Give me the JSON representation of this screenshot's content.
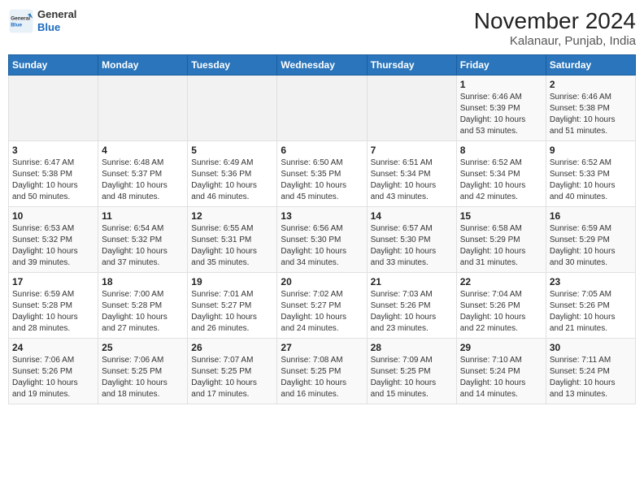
{
  "header": {
    "title": "November 2024",
    "subtitle": "Kalanaur, Punjab, India",
    "logo_line1": "General",
    "logo_line2": "Blue"
  },
  "days_of_week": [
    "Sunday",
    "Monday",
    "Tuesday",
    "Wednesday",
    "Thursday",
    "Friday",
    "Saturday"
  ],
  "weeks": [
    [
      {
        "day": "",
        "info": ""
      },
      {
        "day": "",
        "info": ""
      },
      {
        "day": "",
        "info": ""
      },
      {
        "day": "",
        "info": ""
      },
      {
        "day": "",
        "info": ""
      },
      {
        "day": "1",
        "info": "Sunrise: 6:46 AM\nSunset: 5:39 PM\nDaylight: 10 hours\nand 53 minutes."
      },
      {
        "day": "2",
        "info": "Sunrise: 6:46 AM\nSunset: 5:38 PM\nDaylight: 10 hours\nand 51 minutes."
      }
    ],
    [
      {
        "day": "3",
        "info": "Sunrise: 6:47 AM\nSunset: 5:38 PM\nDaylight: 10 hours\nand 50 minutes."
      },
      {
        "day": "4",
        "info": "Sunrise: 6:48 AM\nSunset: 5:37 PM\nDaylight: 10 hours\nand 48 minutes."
      },
      {
        "day": "5",
        "info": "Sunrise: 6:49 AM\nSunset: 5:36 PM\nDaylight: 10 hours\nand 46 minutes."
      },
      {
        "day": "6",
        "info": "Sunrise: 6:50 AM\nSunset: 5:35 PM\nDaylight: 10 hours\nand 45 minutes."
      },
      {
        "day": "7",
        "info": "Sunrise: 6:51 AM\nSunset: 5:34 PM\nDaylight: 10 hours\nand 43 minutes."
      },
      {
        "day": "8",
        "info": "Sunrise: 6:52 AM\nSunset: 5:34 PM\nDaylight: 10 hours\nand 42 minutes."
      },
      {
        "day": "9",
        "info": "Sunrise: 6:52 AM\nSunset: 5:33 PM\nDaylight: 10 hours\nand 40 minutes."
      }
    ],
    [
      {
        "day": "10",
        "info": "Sunrise: 6:53 AM\nSunset: 5:32 PM\nDaylight: 10 hours\nand 39 minutes."
      },
      {
        "day": "11",
        "info": "Sunrise: 6:54 AM\nSunset: 5:32 PM\nDaylight: 10 hours\nand 37 minutes."
      },
      {
        "day": "12",
        "info": "Sunrise: 6:55 AM\nSunset: 5:31 PM\nDaylight: 10 hours\nand 35 minutes."
      },
      {
        "day": "13",
        "info": "Sunrise: 6:56 AM\nSunset: 5:30 PM\nDaylight: 10 hours\nand 34 minutes."
      },
      {
        "day": "14",
        "info": "Sunrise: 6:57 AM\nSunset: 5:30 PM\nDaylight: 10 hours\nand 33 minutes."
      },
      {
        "day": "15",
        "info": "Sunrise: 6:58 AM\nSunset: 5:29 PM\nDaylight: 10 hours\nand 31 minutes."
      },
      {
        "day": "16",
        "info": "Sunrise: 6:59 AM\nSunset: 5:29 PM\nDaylight: 10 hours\nand 30 minutes."
      }
    ],
    [
      {
        "day": "17",
        "info": "Sunrise: 6:59 AM\nSunset: 5:28 PM\nDaylight: 10 hours\nand 28 minutes."
      },
      {
        "day": "18",
        "info": "Sunrise: 7:00 AM\nSunset: 5:28 PM\nDaylight: 10 hours\nand 27 minutes."
      },
      {
        "day": "19",
        "info": "Sunrise: 7:01 AM\nSunset: 5:27 PM\nDaylight: 10 hours\nand 26 minutes."
      },
      {
        "day": "20",
        "info": "Sunrise: 7:02 AM\nSunset: 5:27 PM\nDaylight: 10 hours\nand 24 minutes."
      },
      {
        "day": "21",
        "info": "Sunrise: 7:03 AM\nSunset: 5:26 PM\nDaylight: 10 hours\nand 23 minutes."
      },
      {
        "day": "22",
        "info": "Sunrise: 7:04 AM\nSunset: 5:26 PM\nDaylight: 10 hours\nand 22 minutes."
      },
      {
        "day": "23",
        "info": "Sunrise: 7:05 AM\nSunset: 5:26 PM\nDaylight: 10 hours\nand 21 minutes."
      }
    ],
    [
      {
        "day": "24",
        "info": "Sunrise: 7:06 AM\nSunset: 5:26 PM\nDaylight: 10 hours\nand 19 minutes."
      },
      {
        "day": "25",
        "info": "Sunrise: 7:06 AM\nSunset: 5:25 PM\nDaylight: 10 hours\nand 18 minutes."
      },
      {
        "day": "26",
        "info": "Sunrise: 7:07 AM\nSunset: 5:25 PM\nDaylight: 10 hours\nand 17 minutes."
      },
      {
        "day": "27",
        "info": "Sunrise: 7:08 AM\nSunset: 5:25 PM\nDaylight: 10 hours\nand 16 minutes."
      },
      {
        "day": "28",
        "info": "Sunrise: 7:09 AM\nSunset: 5:25 PM\nDaylight: 10 hours\nand 15 minutes."
      },
      {
        "day": "29",
        "info": "Sunrise: 7:10 AM\nSunset: 5:24 PM\nDaylight: 10 hours\nand 14 minutes."
      },
      {
        "day": "30",
        "info": "Sunrise: 7:11 AM\nSunset: 5:24 PM\nDaylight: 10 hours\nand 13 minutes."
      }
    ]
  ]
}
